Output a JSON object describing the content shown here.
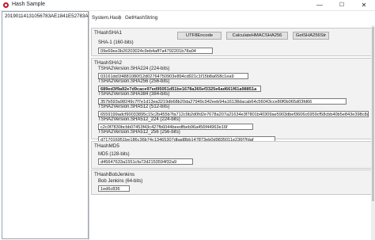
{
  "window": {
    "title": "Hash Sample",
    "controls": {
      "minimize": "—",
      "maximize": "☐",
      "close": "✕"
    }
  },
  "left": {
    "text": "20190114131056783AE1841E52783A"
  },
  "menu": {
    "items": [
      "System.Hash",
      "GetHashString"
    ],
    "separator": "|"
  },
  "sha1": {
    "title": "THashSHA1",
    "label": "SHA-1 (160-bits)",
    "value": "09e69ee3b20203024c9eb4aff7a4792201b78a04",
    "buttons": {
      "utf8": "UTF8Encode",
      "hmac": "CalculateHMACSHA256",
      "sha2": "GetSHA256Str"
    }
  },
  "sha2": {
    "title": "THashSHA2",
    "items": [
      {
        "label": "TSHA2Version.SHA224 (224-bits)",
        "value": "03161dd1f4881080f12d02764750903e894cd921c1f15b8a658c1ea9"
      },
      {
        "label": "TSHA2Version.SHA256 (256-bits)",
        "value": "689ed3f9a92e7d9cace97ed95051d51be1678a365ef3325e6ad661f61a98851a"
      },
      {
        "label": "TSHA2Version.SHA384 (384-bits)",
        "value": "357b593a98249c7f7e1d13ea3219db68b20da27949c942eeb94a16138dacab64c56043cce80f0b065d03fd66"
      },
      {
        "label": "TSHA2Version.SHA512 (512-bits)",
        "value": "6559199adcf90033895c15c2b455b7fa712c9b2d0fd2e7678a207a21634e3f7801b40309ae5903dbef3606c6959cf58cbb40b5e843e398c8a19afa"
      },
      {
        "label": "TSHA2Version.SHA512_224 (224-bits)",
        "value": "c2c0f7830bcbb07453f43c427fb6044beedfbeb96a456f44963e16f"
      },
      {
        "label": "TSHA2Version.SHA512_256 (256-bits)",
        "value": "d717016951be186c36b74c13465307dbad8bb147873eb0d9835011e236f7fdaf"
      }
    ]
  },
  "md5": {
    "title": "THashMD5",
    "label": "MD5 (128-bits)",
    "value": "d45647633a1551cfa72d2153594f32a9"
  },
  "jenkins": {
    "title": "THashBobJenkins",
    "label": "Bob Jenkins (64-bits)",
    "value": "1ed6c836"
  }
}
